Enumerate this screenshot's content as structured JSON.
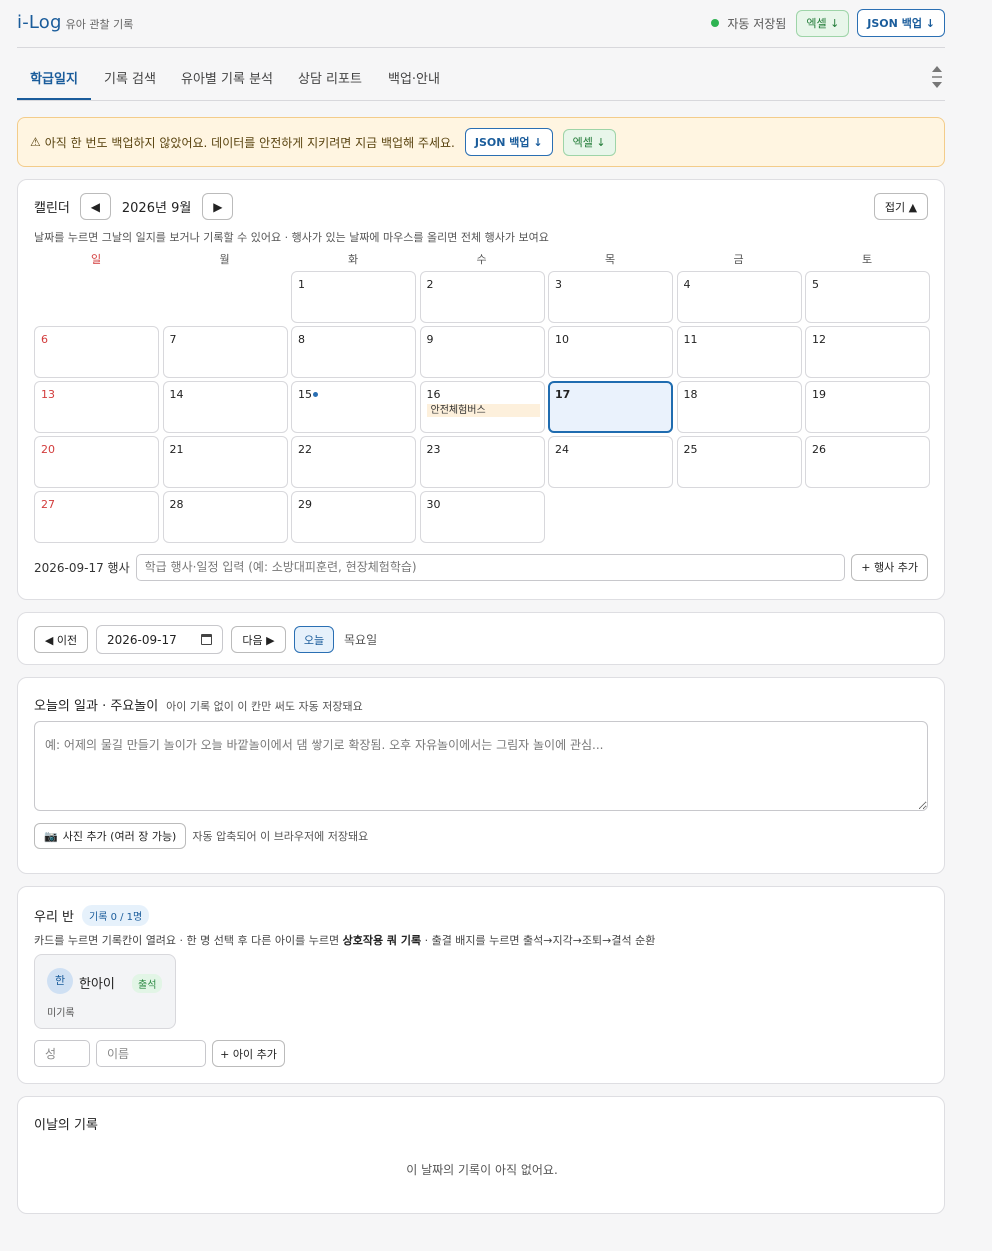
{
  "header": {
    "title": "i-Log",
    "subtitle": "유아 관찰 기록",
    "save_status": "자동 저장됨",
    "excel_label": "엑셀 ↓",
    "json_label": "JSON 백업 ↓"
  },
  "tabs": [
    {
      "label": "학급일지",
      "active": true
    },
    {
      "label": "기록 검색",
      "active": false
    },
    {
      "label": "유아별 기록 분석",
      "active": false
    },
    {
      "label": "상담 리포트",
      "active": false
    },
    {
      "label": "백업·안내",
      "active": false
    }
  ],
  "warning": {
    "text": "아직 한 번도 백업하지 않았어요. 데이터를 안전하게 지키려면 지금 백업해 주세요.",
    "json_label": "JSON 백업 ↓",
    "excel_label": "엑셀 ↓"
  },
  "calendar": {
    "title": "캘린더",
    "month_label": "2026년 9월",
    "fold_label": "접기 ▲",
    "hint": "날짜를 누르면 그날의 일지를 보거나 기록할 수 있어요 · 행사가 있는 날짜에 마우스를 올리면 전체 행사가 보여요",
    "weekdays": [
      "일",
      "월",
      "화",
      "수",
      "목",
      "금",
      "토"
    ],
    "first_weekday": 2,
    "days_in_month": 30,
    "today": 17,
    "dot_days": [
      15
    ],
    "events": [
      {
        "day": 16,
        "text": "안전체험버스"
      }
    ],
    "event_date_label": "2026-09-17 행사",
    "event_placeholder": "학급 행사·일정 입력 (예: 소방대피훈련, 현장체험학습)",
    "add_event_label": "+ 행사 추가"
  },
  "date_nav": {
    "prev_label": "◀ 이전",
    "date_value": "2026-09-17",
    "next_label": "다음 ▶",
    "today_label": "오늘",
    "weekday": "목요일"
  },
  "daily": {
    "title": "오늘의 일과 · 주요놀이",
    "hint": "아이 기록 없이 이 칸만 써도 자동 저장돼요",
    "placeholder": "예: 어제의 물길 만들기 놀이가 오늘 바깥놀이에서 댐 쌓기로 확장됨. 오후 자유놀이에서는 그림자 놀이에 관심...",
    "photo_button": "사진 추가 (여러 장 가능)",
    "photo_note": "자동 압축되어 이 브라우저에 저장돼요"
  },
  "class": {
    "title": "우리 반",
    "record_badge": "기록 0 / 1명",
    "hint_before": "카드를 누르면 기록칸이 열려요 · 한 명 선택 후 다른 아이를 누르면 ",
    "hint_bold": "상호작용 쿼 기록",
    "hint_after": " · 출결 배지를 누르면 출석→지각→조퇴→결석 순환",
    "children": [
      {
        "initial": "한",
        "name": "한아이",
        "attendance": "출석",
        "status": "미기록"
      }
    ],
    "surname_placeholder": "성",
    "name_placeholder": "이름",
    "add_child_label": "+ 아이 추가"
  },
  "records": {
    "title": "이날의 기록",
    "empty_text": "이 날짜의 기록이 아직 없어요."
  },
  "colors": {
    "accent": "#1a5c9b",
    "save_dot": "#2eb352",
    "warning_bg": "#fff5e1",
    "sunday": "#d23c3c",
    "today_bg": "#eaf2fc",
    "event_bg": "#fdf0dc"
  }
}
